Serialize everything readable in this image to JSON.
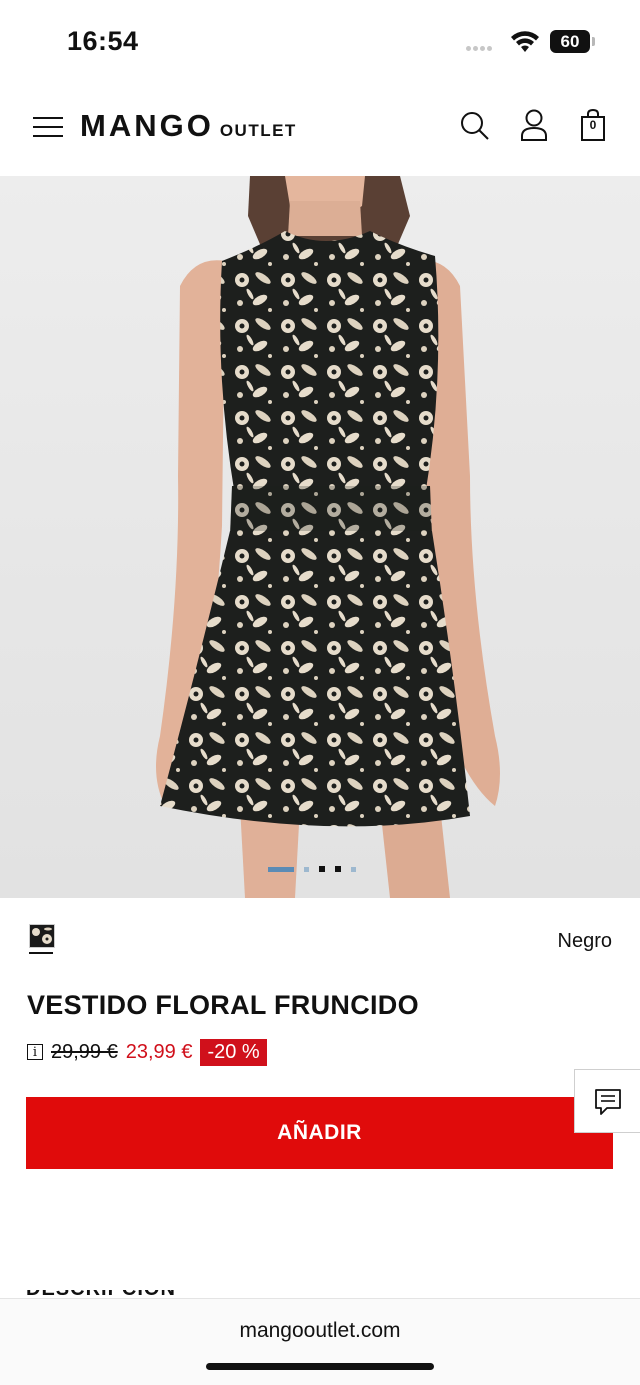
{
  "status": {
    "time": "16:54",
    "battery": "60"
  },
  "header": {
    "logo_main": "MANGO",
    "logo_sub": "OUTLET",
    "bag_count": "0"
  },
  "product": {
    "color_name": "Negro",
    "title": "VESTIDO FLORAL FRUNCIDO",
    "old_price": "29,99 €",
    "new_price": "23,99 €",
    "discount": "-20 %",
    "info_icon_text": "i",
    "add_button": "AÑADIR",
    "description_heading": "DESCRIPCIÓN"
  },
  "carousel": {
    "count": 5,
    "active_index": 0
  },
  "browser": {
    "url": "mangooutlet.com"
  },
  "colors": {
    "accent_red": "#e00b0b",
    "sale_red": "#d0101b",
    "carousel_active": "#5b8bb5"
  }
}
